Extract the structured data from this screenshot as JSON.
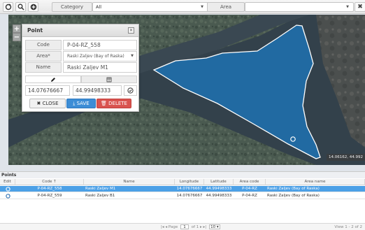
{
  "toolbar": {
    "category_label": "Category",
    "category_value": "All",
    "area_label": "Area",
    "area_value": "",
    "clear_label": "✖"
  },
  "map": {
    "coord_readout": "14.06162, 44.992"
  },
  "dialog": {
    "title": "Point",
    "code_label": "Code",
    "code_value": "P-04-RZ_558",
    "area_label": "Area*",
    "area_value": "Raski Zaljev (Bay of Raska)",
    "name_label": "Name",
    "name_value": "Raski Zaljev M1",
    "longitude": "14.07676667",
    "latitude": "44.99498333",
    "close_label": "CLOSE",
    "save_label": "SAVE",
    "delete_label": "DELETE"
  },
  "grid": {
    "title": "Points",
    "columns": [
      "Edit",
      "Code ↑",
      "Name",
      "Longitude",
      "Latitude",
      "Area code",
      "Area name"
    ],
    "rows": [
      {
        "code": "P-04-RZ_558",
        "name": "Raski Zaljev M1",
        "longitude": "14.07676667",
        "latitude": "44.99498333",
        "area_code": "P-04-RZ",
        "area_name": "Raski Zaljev (Bay of Raska)",
        "selected": true
      },
      {
        "code": "P-04-RZ_559",
        "name": "Raski Zaljev B1",
        "longitude": "14.07676667",
        "latitude": "44.99498333",
        "area_code": "P-04-RZ",
        "area_name": "Raski Zaljev (Bay of Raska)",
        "selected": false
      }
    ],
    "pager": {
      "page_label": "Page",
      "page_value": "1",
      "of_label": "of 1",
      "per_page": "10",
      "view_text": "View 1 - 2 of 2"
    }
  },
  "colors": {
    "polygon_fill": "#1f6fae",
    "selected_row": "#4ca0e6",
    "save_button": "#3c8dd6",
    "delete_button": "#d9534f"
  }
}
